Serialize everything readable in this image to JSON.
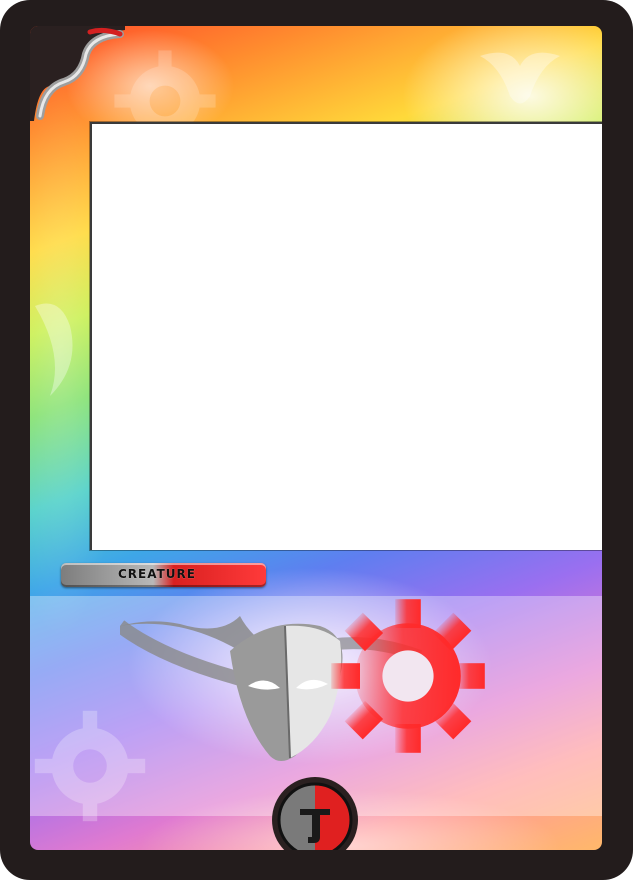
{
  "card": {
    "type_label": "CREATURE",
    "colors": {
      "frame_border": "#231c1c",
      "accent_red": "#ff2a2a",
      "accent_gray": "#9a9a9a",
      "art_window": "#ffffff"
    },
    "icons": {
      "corner": "corner-ornament-icon",
      "watermark_mask": "winged-mask-icon",
      "watermark_gear": "gear-icon",
      "cost_symbol": "cost-emblem-icon"
    }
  }
}
